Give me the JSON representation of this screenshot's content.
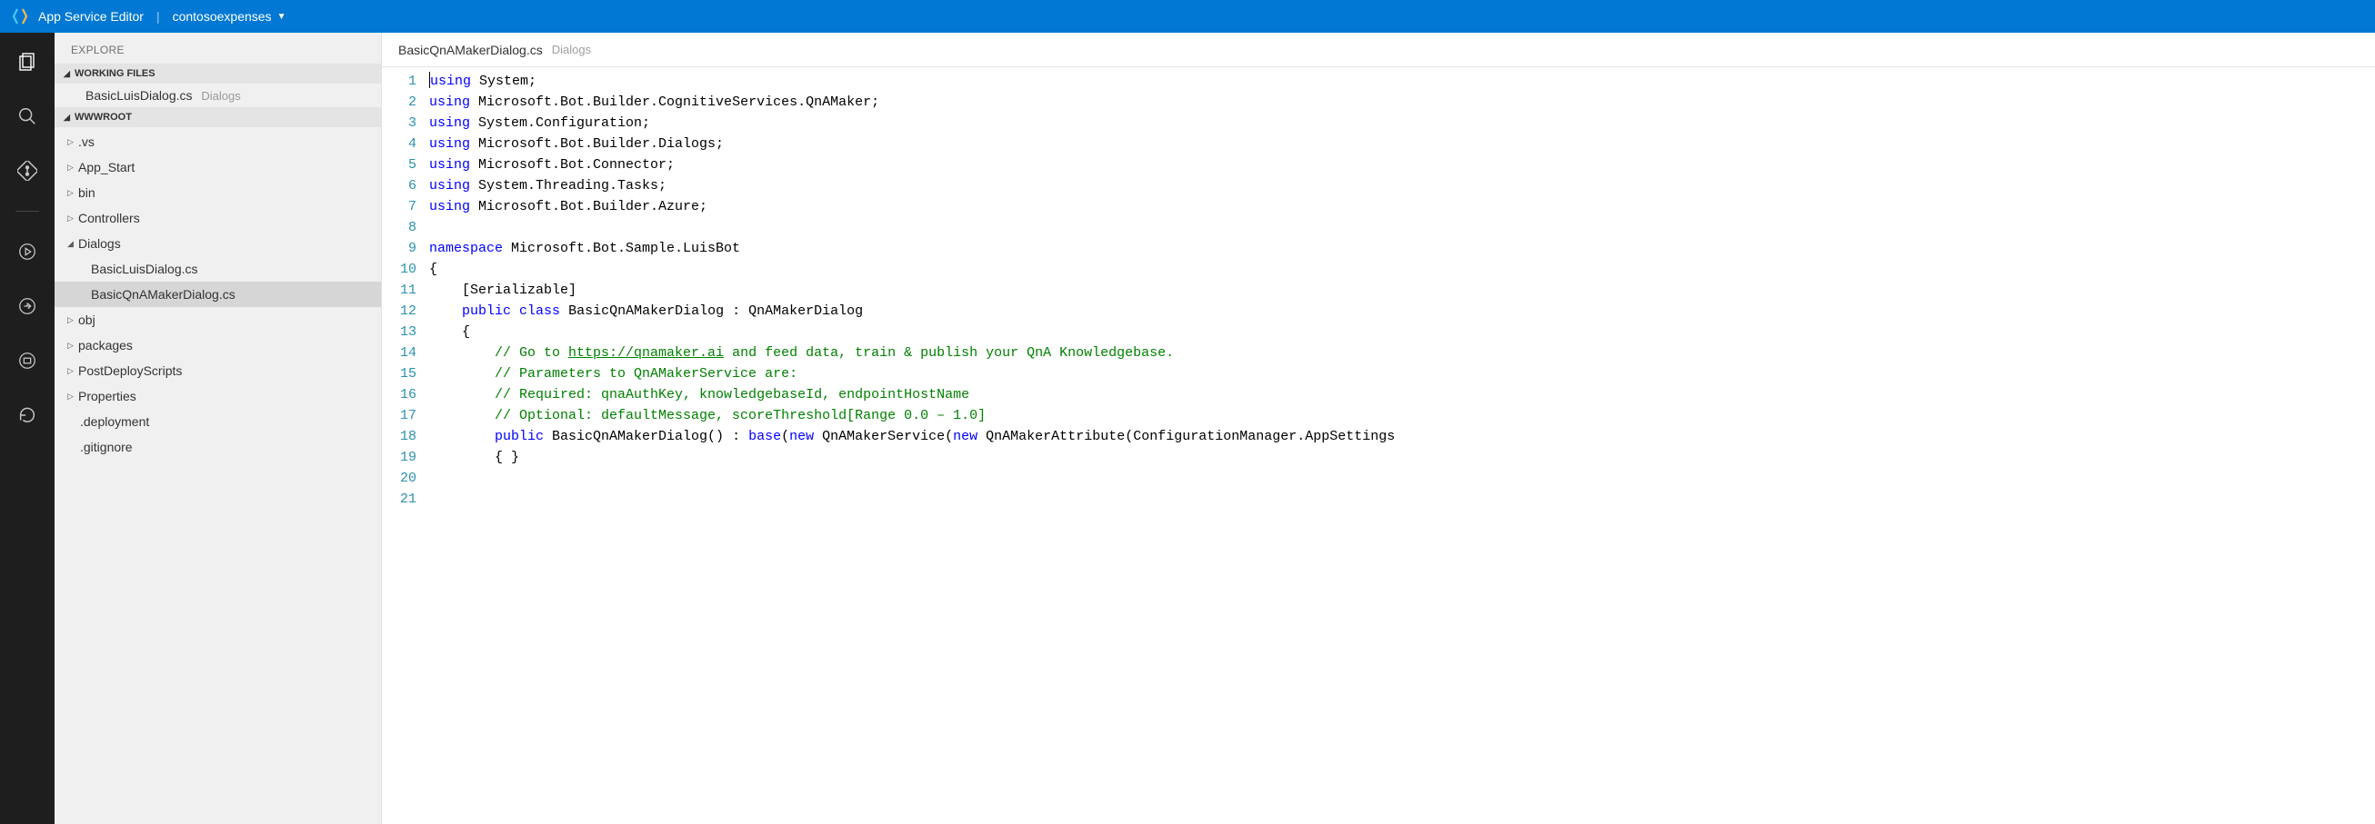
{
  "header": {
    "app_title": "App Service Editor",
    "project_name": "contosoexpenses"
  },
  "activity": {
    "items": [
      "files",
      "search",
      "git",
      "run",
      "signout",
      "output",
      "refresh"
    ]
  },
  "sidebar": {
    "title": "EXPLORE",
    "sections": {
      "working_files": {
        "label": "WORKING FILES",
        "items": [
          {
            "name": "BasicLuisDialog.cs",
            "hint": "Dialogs"
          }
        ]
      },
      "root": {
        "label": "WWWROOT",
        "tree": [
          {
            "label": ".vs",
            "type": "folder",
            "depth": 0,
            "expanded": false
          },
          {
            "label": "App_Start",
            "type": "folder",
            "depth": 0,
            "expanded": false
          },
          {
            "label": "bin",
            "type": "folder",
            "depth": 0,
            "expanded": false
          },
          {
            "label": "Controllers",
            "type": "folder",
            "depth": 0,
            "expanded": false
          },
          {
            "label": "Dialogs",
            "type": "folder",
            "depth": 0,
            "expanded": true
          },
          {
            "label": "BasicLuisDialog.cs",
            "type": "file",
            "depth": 1
          },
          {
            "label": "BasicQnAMakerDialog.cs",
            "type": "file",
            "depth": 1,
            "selected": true
          },
          {
            "label": "obj",
            "type": "folder",
            "depth": 0,
            "expanded": false
          },
          {
            "label": "packages",
            "type": "folder",
            "depth": 0,
            "expanded": false
          },
          {
            "label": "PostDeployScripts",
            "type": "folder",
            "depth": 0,
            "expanded": false
          },
          {
            "label": "Properties",
            "type": "folder",
            "depth": 0,
            "expanded": false
          },
          {
            "label": ".deployment",
            "type": "file",
            "depth": 0
          },
          {
            "label": ".gitignore",
            "type": "file",
            "depth": 0
          }
        ]
      }
    }
  },
  "editor": {
    "tab_filename": "BasicQnAMakerDialog.cs",
    "tab_path": "Dialogs",
    "line_count": 21,
    "lines": [
      [
        {
          "t": "using",
          "c": "kw"
        },
        {
          "t": " System;"
        }
      ],
      [
        {
          "t": "using",
          "c": "kw"
        },
        {
          "t": " Microsoft.Bot.Builder.CognitiveServices.QnAMaker;"
        }
      ],
      [
        {
          "t": "using",
          "c": "kw"
        },
        {
          "t": " System.Configuration;"
        }
      ],
      [
        {
          "t": "using",
          "c": "kw"
        },
        {
          "t": " Microsoft.Bot.Builder.Dialogs;"
        }
      ],
      [
        {
          "t": "using",
          "c": "kw"
        },
        {
          "t": " Microsoft.Bot.Connector;"
        }
      ],
      [
        {
          "t": "using",
          "c": "kw"
        },
        {
          "t": " System.Threading.Tasks;"
        }
      ],
      [
        {
          "t": "using",
          "c": "kw"
        },
        {
          "t": " Microsoft.Bot.Builder.Azure;"
        }
      ],
      [],
      [
        {
          "t": "namespace",
          "c": "kw"
        },
        {
          "t": " Microsoft.Bot.Sample.LuisBot"
        }
      ],
      [
        {
          "t": "{"
        }
      ],
      [
        {
          "t": "    [Serializable]"
        }
      ],
      [
        {
          "t": "    "
        },
        {
          "t": "public",
          "c": "kw"
        },
        {
          "t": " "
        },
        {
          "t": "class",
          "c": "kw"
        },
        {
          "t": " BasicQnAMakerDialog : QnAMakerDialog"
        }
      ],
      [
        {
          "t": "    {"
        }
      ],
      [
        {
          "t": "        "
        },
        {
          "t": "// Go to ",
          "c": "cm"
        },
        {
          "t": "https://qnamaker.ai",
          "c": "cm",
          "link": true
        },
        {
          "t": " and feed data, train & publish your QnA Knowledgebase.",
          "c": "cm"
        }
      ],
      [
        {
          "t": "        "
        },
        {
          "t": "// Parameters to QnAMakerService are:",
          "c": "cm"
        }
      ],
      [
        {
          "t": "        "
        },
        {
          "t": "// Required: qnaAuthKey, knowledgebaseId, endpointHostName",
          "c": "cm"
        }
      ],
      [
        {
          "t": "        "
        },
        {
          "t": "// Optional: defaultMessage, scoreThreshold[Range 0.0 – 1.0]",
          "c": "cm"
        }
      ],
      [
        {
          "t": "        "
        },
        {
          "t": "public",
          "c": "kw"
        },
        {
          "t": " BasicQnAMakerDialog() : "
        },
        {
          "t": "base",
          "c": "kw"
        },
        {
          "t": "("
        },
        {
          "t": "new",
          "c": "kw"
        },
        {
          "t": " QnAMakerService("
        },
        {
          "t": "new",
          "c": "kw"
        },
        {
          "t": " QnAMakerAttribute(ConfigurationManager.AppSettings"
        }
      ],
      [
        {
          "t": "        { }"
        }
      ],
      []
    ]
  }
}
